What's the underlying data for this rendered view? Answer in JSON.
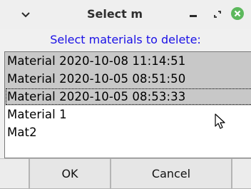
{
  "window": {
    "title": "Select m"
  },
  "titlebar_icons": [
    "chevron-down-icon",
    "minimize-icon",
    "maximize-icon",
    "close-icon"
  ],
  "prompt": "Select materials to delete:",
  "materials": [
    {
      "label": "Material  2020-10-08 11:14:51",
      "selected": true
    },
    {
      "label": "Material  2020-10-05 08:51:50",
      "selected": true
    },
    {
      "label": "Material  2020-10-05 08:53:33",
      "selected": true,
      "focused": true
    },
    {
      "label": "Material 1",
      "selected": false
    },
    {
      "label": "Mat2",
      "selected": false
    }
  ],
  "buttons": {
    "ok_label": "OK",
    "cancel_label": "Cancel"
  },
  "colors": {
    "prompt_text": "#1a10e6",
    "close_button": "#5cb85c",
    "selection": "#c8c8c8"
  }
}
